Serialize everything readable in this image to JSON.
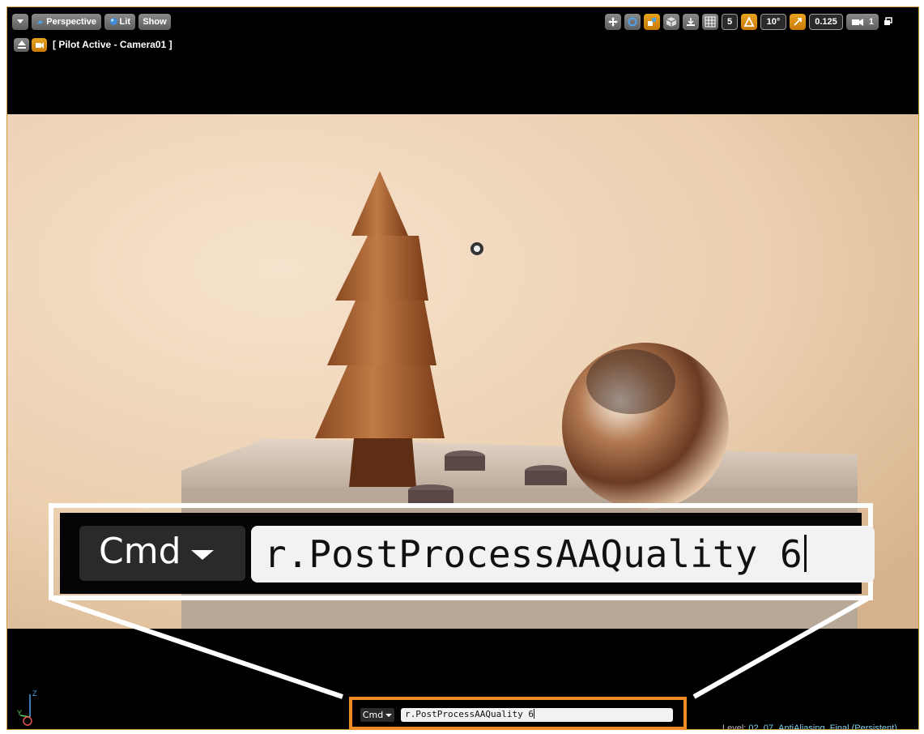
{
  "viewport": {
    "toolbar_left": {
      "menu_icon": "dropdown-icon",
      "perspective_label": "Perspective",
      "lit_label": "Lit",
      "show_label": "Show"
    },
    "pilot_label": "[ Pilot Active - Camera01 ]",
    "toolbar_right": {
      "grid_snap_value": "5",
      "rotation_snap_value": "10°",
      "scale_snap_value": "0.125",
      "camera_speed_value": "1"
    }
  },
  "zoom_callout": {
    "cmd_label": "Cmd",
    "command_text": "r.PostProcessAAQuality 6"
  },
  "console": {
    "cmd_label": "Cmd",
    "command_text": "r.PostProcessAAQuality 6"
  },
  "status": {
    "level_label": "Level:",
    "level_name": "02_07_AntiAliasing_Final (Persistent)"
  },
  "axis": {
    "z": "Z",
    "y": "Y"
  },
  "colors": {
    "highlight_orange": "#f08a24",
    "toolbar_orange": "#e9a21f",
    "level_name": "#7fd0f0"
  }
}
